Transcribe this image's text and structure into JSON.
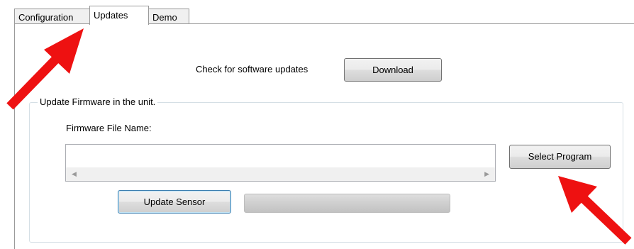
{
  "tabs": [
    {
      "label": "Configuration",
      "active": false
    },
    {
      "label": "Updates",
      "active": true
    },
    {
      "label": "Demo",
      "active": false
    }
  ],
  "updates": {
    "check_label": "Check for software updates",
    "download_button": "Download"
  },
  "firmware": {
    "group_title": "Update Firmware in the unit.",
    "file_name_label": "Firmware File Name:",
    "file_name_value": "",
    "select_button": "Select Program",
    "update_button": "Update Sensor",
    "progress": 0
  },
  "annotations": {
    "arrow_color": "#ee1111"
  }
}
